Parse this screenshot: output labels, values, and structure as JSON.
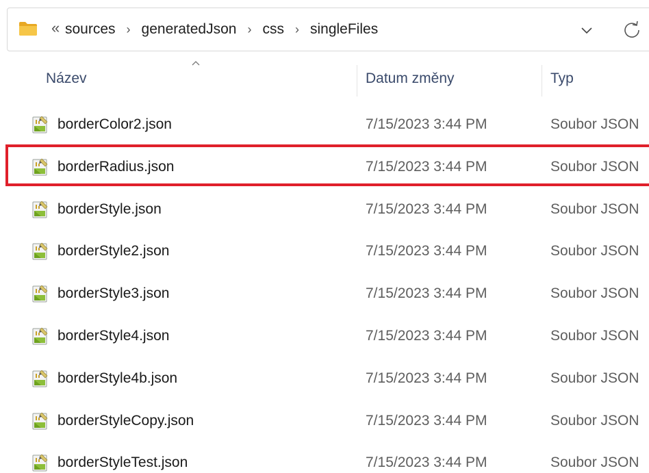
{
  "address_bar": {
    "overflow_glyph": "«",
    "crumbs": [
      "sources",
      "generatedJson",
      "css",
      "singleFiles"
    ]
  },
  "columns": {
    "name": "Název",
    "date": "Datum změny",
    "type": "Typ"
  },
  "files": [
    {
      "name": "borderColor2.json",
      "date": "7/15/2023 3:44 PM",
      "type": "Soubor JSON"
    },
    {
      "name": "borderRadius.json",
      "date": "7/15/2023 3:44 PM",
      "type": "Soubor JSON"
    },
    {
      "name": "borderStyle.json",
      "date": "7/15/2023 3:44 PM",
      "type": "Soubor JSON"
    },
    {
      "name": "borderStyle2.json",
      "date": "7/15/2023 3:44 PM",
      "type": "Soubor JSON"
    },
    {
      "name": "borderStyle3.json",
      "date": "7/15/2023 3:44 PM",
      "type": "Soubor JSON"
    },
    {
      "name": "borderStyle4.json",
      "date": "7/15/2023 3:44 PM",
      "type": "Soubor JSON"
    },
    {
      "name": "borderStyle4b.json",
      "date": "7/15/2023 3:44 PM",
      "type": "Soubor JSON"
    },
    {
      "name": "borderStyleCopy.json",
      "date": "7/15/2023 3:44 PM",
      "type": "Soubor JSON"
    },
    {
      "name": "borderStyleTest.json",
      "date": "7/15/2023 3:44 PM",
      "type": "Soubor JSON"
    }
  ],
  "icons": {
    "folder": "folder-icon",
    "file": "json-file-icon",
    "dropdown": "chevron-down-icon",
    "refresh": "refresh-icon",
    "sort": "sort-ascending-icon"
  },
  "colors": {
    "highlight": "#e0202b",
    "folder": "#f2c14e",
    "header_text": "#3a4a6b"
  }
}
